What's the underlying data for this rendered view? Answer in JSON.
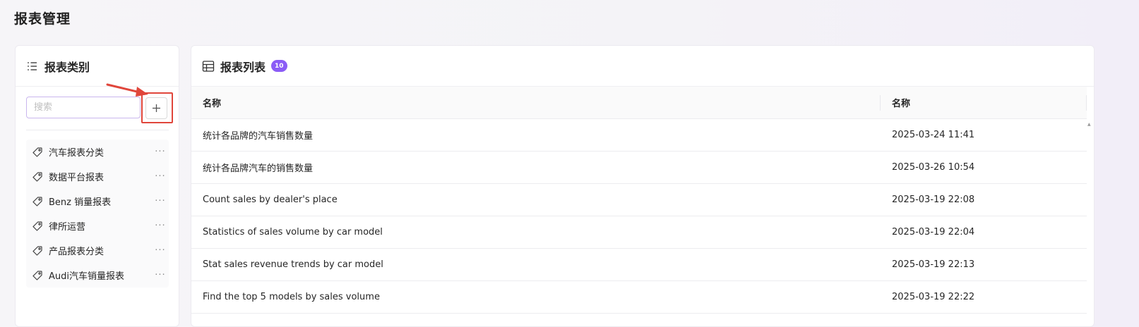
{
  "page": {
    "title": "报表管理"
  },
  "categories": {
    "title": "报表类别",
    "search_placeholder": "搜索",
    "add_label": "+",
    "items": [
      {
        "label": "汽车报表分类"
      },
      {
        "label": "数据平台报表"
      },
      {
        "label": "Benz 销量报表"
      },
      {
        "label": "律所运营"
      },
      {
        "label": "产品报表分类"
      },
      {
        "label": "Audi汽车销量报表"
      }
    ],
    "more_label": "···"
  },
  "reports": {
    "title": "报表列表",
    "count": "10",
    "columns": [
      "名称",
      "名称"
    ],
    "rows": [
      {
        "name": "统计各品牌的汽车销售数量",
        "time": "2025-03-24 11:41"
      },
      {
        "name": "统计各品牌汽车的销售数量",
        "time": "2025-03-26 10:54"
      },
      {
        "name": "Count sales by dealer's place",
        "time": "2025-03-19 22:08"
      },
      {
        "name": "Statistics of sales volume by car model",
        "time": "2025-03-19 22:04"
      },
      {
        "name": "Stat sales revenue trends by car model",
        "time": "2025-03-19 22:13"
      },
      {
        "name": "Find the top 5 models by sales volume",
        "time": "2025-03-19 22:22"
      }
    ]
  },
  "colors": {
    "accent": "#8b5cf6",
    "highlight": "#e0463b"
  }
}
